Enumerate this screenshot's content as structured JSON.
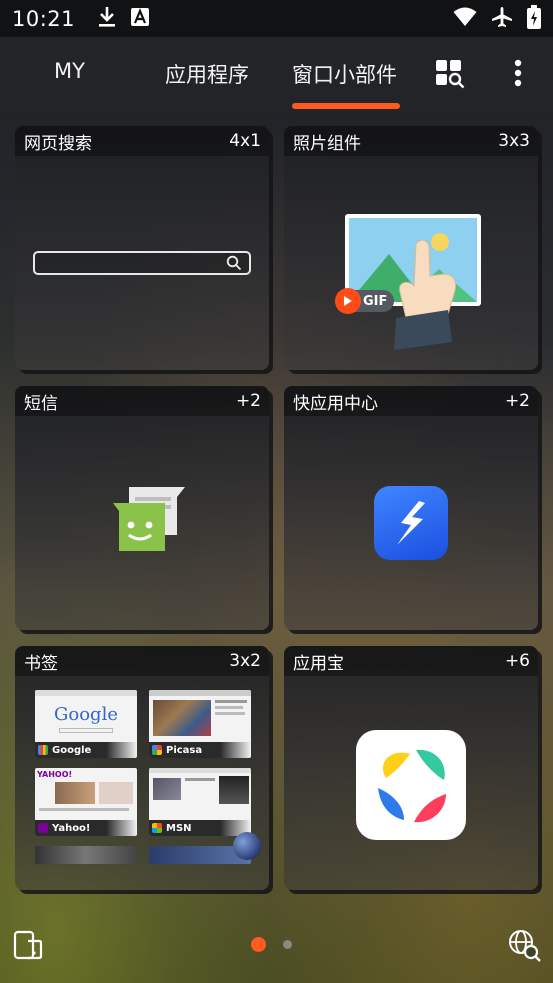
{
  "status_bar": {
    "time": "10:21",
    "left_icons": [
      "download-icon",
      "font-icon"
    ],
    "right_icons": [
      "wifi-icon",
      "airplane-icon",
      "battery-icon"
    ]
  },
  "tabs": {
    "items": [
      {
        "label": "MY"
      },
      {
        "label": "应用程序"
      },
      {
        "label": "窗口小部件"
      }
    ],
    "active_index": 2,
    "accent_color": "#ff5a1f",
    "actions": [
      "widget-search-icon",
      "more-vert-icon"
    ]
  },
  "widgets": [
    {
      "title": "网页搜索",
      "size": "4x1"
    },
    {
      "title": "照片组件",
      "size": "3x3",
      "badge": "GIF"
    },
    {
      "title": "短信",
      "size": "+2"
    },
    {
      "title": "快应用中心",
      "size": "+2"
    },
    {
      "title": "书签",
      "size": "3x2",
      "bookmarks": [
        {
          "label": "Google",
          "logo": "Google"
        },
        {
          "label": "Picasa"
        },
        {
          "label": "Yahoo!",
          "logo": "YAHOO!"
        },
        {
          "label": "MSN"
        }
      ]
    },
    {
      "title": "应用宝",
      "size": "+6"
    }
  ],
  "bottom_bar": {
    "left_icon": "phone-tablet-icon",
    "right_icon": "globe-search-icon",
    "page_count": 2,
    "current_page": 1
  }
}
